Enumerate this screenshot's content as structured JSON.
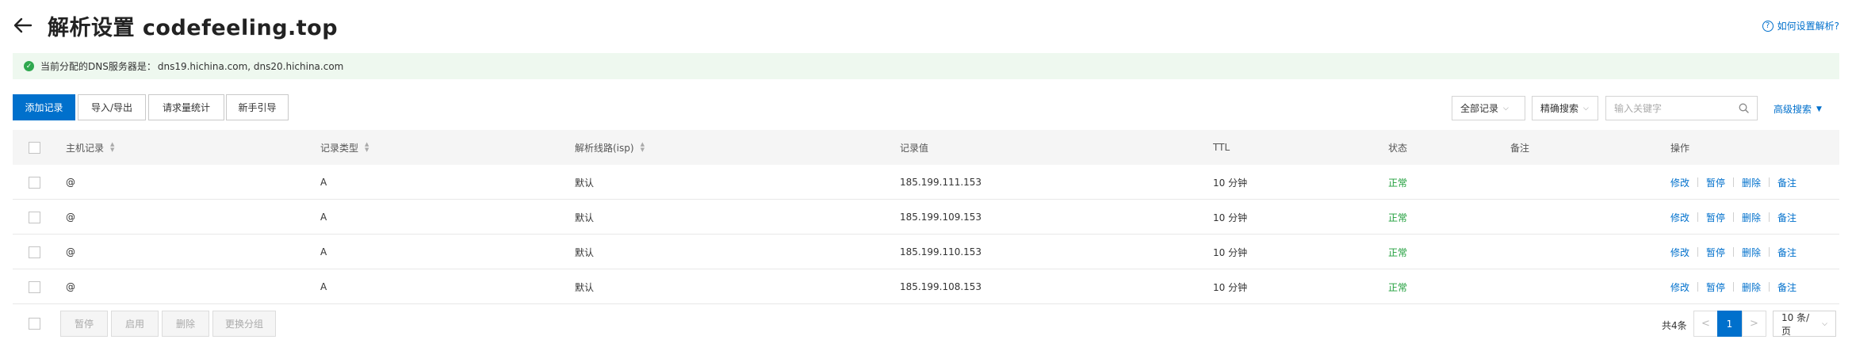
{
  "header": {
    "title": "解析设置 codefeeling.top",
    "help_link": "如何设置解析?"
  },
  "alert": {
    "label": "当前分配的DNS服务器是：",
    "value": "dns19.hichina.com, dns20.hichina.com"
  },
  "toolbar": {
    "add_record": "添加记录",
    "import_export": "导入/导出",
    "request_stats": "请求量统计",
    "guide": "新手引导",
    "filter_all": "全部记录",
    "exact_search": "精确搜索",
    "search_placeholder": "输入关键字",
    "advanced_search": "高级搜索"
  },
  "table": {
    "columns": {
      "host": "主机记录",
      "type": "记录类型",
      "line": "解析线路(isp)",
      "value": "记录值",
      "ttl": "TTL",
      "status": "状态",
      "remark": "备注",
      "actions": "操作"
    },
    "rows": [
      {
        "host": "@",
        "type": "A",
        "line": "默认",
        "value": "185.199.111.153",
        "ttl": "10 分钟",
        "status": "正常",
        "remark": ""
      },
      {
        "host": "@",
        "type": "A",
        "line": "默认",
        "value": "185.199.109.153",
        "ttl": "10 分钟",
        "status": "正常",
        "remark": ""
      },
      {
        "host": "@",
        "type": "A",
        "line": "默认",
        "value": "185.199.110.153",
        "ttl": "10 分钟",
        "status": "正常",
        "remark": ""
      },
      {
        "host": "@",
        "type": "A",
        "line": "默认",
        "value": "185.199.108.153",
        "ttl": "10 分钟",
        "status": "正常",
        "remark": ""
      }
    ],
    "actions": {
      "edit": "修改",
      "pause": "暂停",
      "delete": "删除",
      "remark": "备注"
    }
  },
  "footer": {
    "pause": "暂停",
    "enable": "启用",
    "delete": "删除",
    "change_group": "更换分组",
    "total": "共4条",
    "prev": "<",
    "page": "1",
    "next": ">",
    "page_size": "10 条/页"
  },
  "colors": {
    "accent": "#0070cc",
    "status_ok": "#1e9e3a",
    "alert_bg": "#eef8ef"
  },
  "icons": {
    "back": "back-arrow-icon",
    "help": "question-circle-icon",
    "alert": "check-circle-icon",
    "search": "search-icon"
  }
}
